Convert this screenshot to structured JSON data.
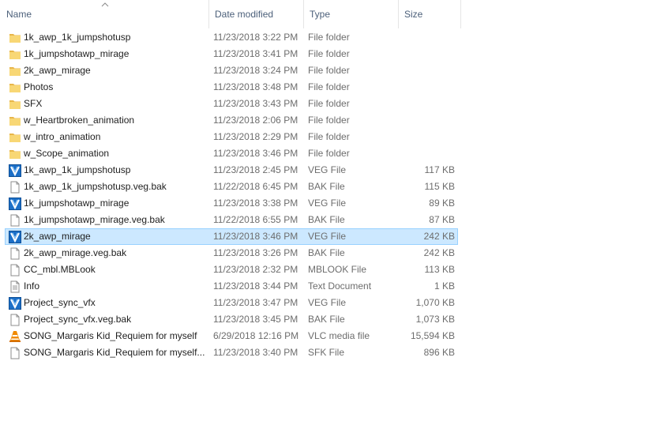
{
  "columns": {
    "name": "Name",
    "date": "Date modified",
    "type": "Type",
    "size": "Size"
  },
  "files": [
    {
      "name": "1k_awp_1k_jumpshotusp",
      "date": "11/23/2018 3:22 PM",
      "type": "File folder",
      "size": "",
      "icon": "folder-icon",
      "selected": false
    },
    {
      "name": "1k_jumpshotawp_mirage",
      "date": "11/23/2018 3:41 PM",
      "type": "File folder",
      "size": "",
      "icon": "folder-icon",
      "selected": false
    },
    {
      "name": "2k_awp_mirage",
      "date": "11/23/2018 3:24 PM",
      "type": "File folder",
      "size": "",
      "icon": "folder-icon",
      "selected": false
    },
    {
      "name": "Photos",
      "date": "11/23/2018 3:48 PM",
      "type": "File folder",
      "size": "",
      "icon": "folder-icon",
      "selected": false
    },
    {
      "name": "SFX",
      "date": "11/23/2018 3:43 PM",
      "type": "File folder",
      "size": "",
      "icon": "folder-icon",
      "selected": false
    },
    {
      "name": "w_Heartbroken_animation",
      "date": "11/23/2018 2:06 PM",
      "type": "File folder",
      "size": "",
      "icon": "folder-icon",
      "selected": false
    },
    {
      "name": "w_intro_animation",
      "date": "11/23/2018 2:29 PM",
      "type": "File folder",
      "size": "",
      "icon": "folder-icon",
      "selected": false
    },
    {
      "name": "w_Scope_animation",
      "date": "11/23/2018 3:46 PM",
      "type": "File folder",
      "size": "",
      "icon": "folder-icon",
      "selected": false
    },
    {
      "name": "1k_awp_1k_jumpshotusp",
      "date": "11/23/2018 2:45 PM",
      "type": "VEG File",
      "size": "117 KB",
      "icon": "veg-file-icon",
      "selected": false
    },
    {
      "name": "1k_awp_1k_jumpshotusp.veg.bak",
      "date": "11/22/2018 6:45 PM",
      "type": "BAK File",
      "size": "115 KB",
      "icon": "blank-file-icon",
      "selected": false
    },
    {
      "name": "1k_jumpshotawp_mirage",
      "date": "11/23/2018 3:38 PM",
      "type": "VEG File",
      "size": "89 KB",
      "icon": "veg-file-icon",
      "selected": false
    },
    {
      "name": "1k_jumpshotawp_mirage.veg.bak",
      "date": "11/22/2018 6:55 PM",
      "type": "BAK File",
      "size": "87 KB",
      "icon": "blank-file-icon",
      "selected": false
    },
    {
      "name": "2k_awp_mirage",
      "date": "11/23/2018 3:46 PM",
      "type": "VEG File",
      "size": "242 KB",
      "icon": "veg-file-icon",
      "selected": true
    },
    {
      "name": "2k_awp_mirage.veg.bak",
      "date": "11/23/2018 3:26 PM",
      "type": "BAK File",
      "size": "242 KB",
      "icon": "blank-file-icon",
      "selected": false
    },
    {
      "name": "CC_mbl.MBLook",
      "date": "11/23/2018 2:32 PM",
      "type": "MBLOOK File",
      "size": "113 KB",
      "icon": "blank-file-icon",
      "selected": false
    },
    {
      "name": "Info",
      "date": "11/23/2018 3:44 PM",
      "type": "Text Document",
      "size": "1 KB",
      "icon": "text-document-icon",
      "selected": false
    },
    {
      "name": "Project_sync_vfx",
      "date": "11/23/2018 3:47 PM",
      "type": "VEG File",
      "size": "1,070 KB",
      "icon": "veg-file-icon",
      "selected": false
    },
    {
      "name": "Project_sync_vfx.veg.bak",
      "date": "11/23/2018 3:45 PM",
      "type": "BAK File",
      "size": "1,073 KB",
      "icon": "blank-file-icon",
      "selected": false
    },
    {
      "name": "SONG_Margaris Kid_Requiem for myself",
      "date": "6/29/2018 12:16 PM",
      "type": "VLC media file",
      "size": "15,594 KB",
      "icon": "vlc-cone-icon",
      "selected": false
    },
    {
      "name": "SONG_Margaris Kid_Requiem for myself....",
      "date": "11/23/2018 3:40 PM",
      "type": "SFK File",
      "size": "896 KB",
      "icon": "blank-file-icon",
      "selected": false
    }
  ],
  "colors": {
    "folder": "#f8d775",
    "selection": "#cce8ff",
    "selection_border": "#99d1ff",
    "header_text": "#4c607a",
    "secondary_text": "#6d6d6d",
    "veg_blue": "#1c6fc7",
    "vlc_orange": "#f08a00"
  }
}
